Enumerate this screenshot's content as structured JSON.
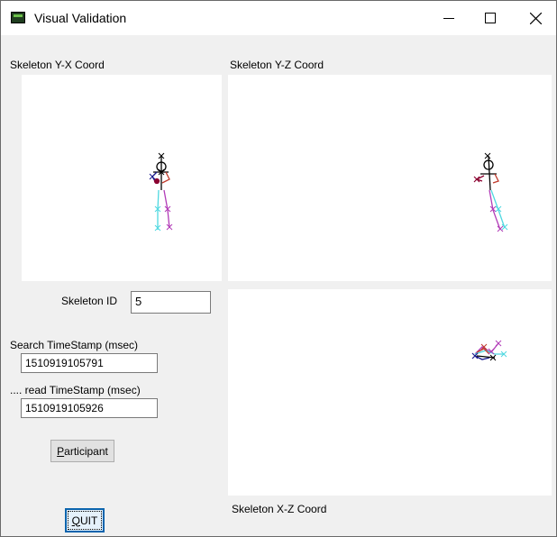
{
  "window": {
    "title": "Visual Validation"
  },
  "labels": {
    "yx_panel": "Skeleton Y-X Coord",
    "yz_panel": "Skeleton Y-Z Coord",
    "xz_panel": "Skeleton X-Z Coord",
    "skeleton_id": "Skeleton ID",
    "search_timestamp": "Search TimeStamp (msec)",
    "read_timestamp": ".... read TimeStamp (msec)"
  },
  "fields": {
    "skeleton_id": "5",
    "search_timestamp": "1510919105791",
    "read_timestamp": "1510919105926"
  },
  "buttons": {
    "participant": {
      "accel": "P",
      "rest": "articipant"
    },
    "quit": {
      "accel": "Q",
      "rest": "UIT"
    }
  },
  "colors": {
    "torso": "#000000",
    "left_leg": "#4fd8e0",
    "right_leg": "#b23cb8",
    "left_arm": "#1a1a8c",
    "right_arm": "#c0392b",
    "hand": "#8b0030"
  }
}
